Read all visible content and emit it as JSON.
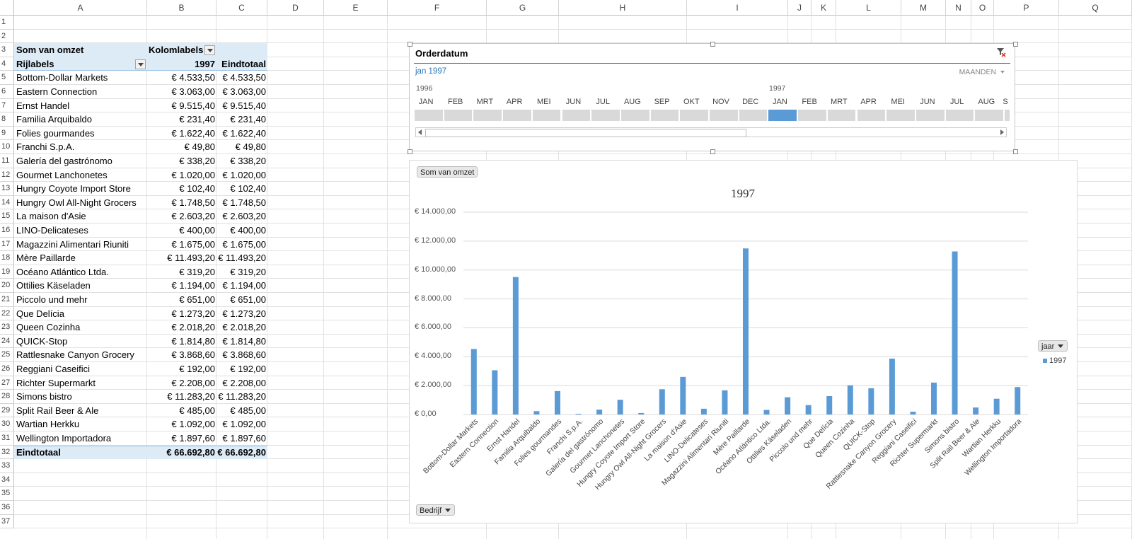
{
  "columns": [
    "A",
    "B",
    "C",
    "D",
    "E",
    "F",
    "G",
    "H",
    "I",
    "J",
    "K",
    "L",
    "M",
    "N",
    "O",
    "P",
    "Q"
  ],
  "rows": [
    "1",
    "2",
    "3",
    "4",
    "5",
    "6",
    "7",
    "8",
    "9",
    "10",
    "11",
    "12",
    "13",
    "14",
    "15",
    "16",
    "17",
    "18",
    "19",
    "20",
    "21",
    "22",
    "23",
    "24",
    "25",
    "26",
    "27",
    "28",
    "29",
    "30",
    "31",
    "32",
    "33",
    "34",
    "35",
    "36",
    "37"
  ],
  "pivot": {
    "value_field": "Som van omzet",
    "col_labels": "Kolomlabels",
    "row_labels": "Rijlabels",
    "col_year": "1997",
    "col_total": "Eindtotaal",
    "rows": [
      {
        "name": "Bottom-Dollar Markets",
        "v1997": "€ 4.533,50",
        "total": "€ 4.533,50"
      },
      {
        "name": "Eastern Connection",
        "v1997": "€ 3.063,00",
        "total": "€ 3.063,00"
      },
      {
        "name": "Ernst Handel",
        "v1997": "€ 9.515,40",
        "total": "€ 9.515,40"
      },
      {
        "name": "Familia Arquibaldo",
        "v1997": "€ 231,40",
        "total": "€ 231,40"
      },
      {
        "name": "Folies gourmandes",
        "v1997": "€ 1.622,40",
        "total": "€ 1.622,40"
      },
      {
        "name": "Franchi S.p.A.",
        "v1997": "€ 49,80",
        "total": "€ 49,80"
      },
      {
        "name": "Galería del gastrónomo",
        "v1997": "€ 338,20",
        "total": "€ 338,20"
      },
      {
        "name": "Gourmet Lanchonetes",
        "v1997": "€ 1.020,00",
        "total": "€ 1.020,00"
      },
      {
        "name": "Hungry Coyote Import Store",
        "v1997": "€ 102,40",
        "total": "€ 102,40"
      },
      {
        "name": "Hungry Owl All-Night Grocers",
        "v1997": "€ 1.748,50",
        "total": "€ 1.748,50"
      },
      {
        "name": "La maison d'Asie",
        "v1997": "€ 2.603,20",
        "total": "€ 2.603,20"
      },
      {
        "name": "LINO-Delicateses",
        "v1997": "€ 400,00",
        "total": "€ 400,00"
      },
      {
        "name": "Magazzini Alimentari Riuniti",
        "v1997": "€ 1.675,00",
        "total": "€ 1.675,00"
      },
      {
        "name": "Mère Paillarde",
        "v1997": "€ 11.493,20",
        "total": "€ 11.493,20"
      },
      {
        "name": "Océano Atlántico Ltda.",
        "v1997": "€ 319,20",
        "total": "€ 319,20"
      },
      {
        "name": "Ottilies Käseladen",
        "v1997": "€ 1.194,00",
        "total": "€ 1.194,00"
      },
      {
        "name": "Piccolo und mehr",
        "v1997": "€ 651,00",
        "total": "€ 651,00"
      },
      {
        "name": "Que Delícia",
        "v1997": "€ 1.273,20",
        "total": "€ 1.273,20"
      },
      {
        "name": "Queen Cozinha",
        "v1997": "€ 2.018,20",
        "total": "€ 2.018,20"
      },
      {
        "name": "QUICK-Stop",
        "v1997": "€ 1.814,80",
        "total": "€ 1.814,80"
      },
      {
        "name": "Rattlesnake Canyon Grocery",
        "v1997": "€ 3.868,60",
        "total": "€ 3.868,60"
      },
      {
        "name": "Reggiani Caseifici",
        "v1997": "€ 192,00",
        "total": "€ 192,00"
      },
      {
        "name": "Richter Supermarkt",
        "v1997": "€ 2.208,00",
        "total": "€ 2.208,00"
      },
      {
        "name": "Simons bistro",
        "v1997": "€ 11.283,20",
        "total": "€ 11.283,20"
      },
      {
        "name": "Split Rail Beer & Ale",
        "v1997": "€ 485,00",
        "total": "€ 485,00"
      },
      {
        "name": "Wartian Herkku",
        "v1997": "€ 1.092,00",
        "total": "€ 1.092,00"
      },
      {
        "name": "Wellington Importadora",
        "v1997": "€ 1.897,60",
        "total": "€ 1.897,60"
      }
    ],
    "grand_label": "Eindtotaal",
    "grand_1997": "€ 66.692,80",
    "grand_total": "€ 66.692,80"
  },
  "slicer": {
    "title": "Orderdatum",
    "selection": "jan 1997",
    "level": "MAANDEN",
    "year1": "1996",
    "year2": "1997",
    "months": [
      "JAN",
      "FEB",
      "MRT",
      "APR",
      "MEI",
      "JUN",
      "JUL",
      "AUG",
      "SEP",
      "OKT",
      "NOV",
      "DEC",
      "JAN",
      "FEB",
      "MRT",
      "APR",
      "MEI",
      "JUN",
      "JUL",
      "AUG",
      "S"
    ],
    "selected_index": 12
  },
  "chart_field_buttons": {
    "value": "Som van omzet",
    "axis": "Bedrijf",
    "legend": "jaar"
  },
  "colors": {
    "bar": "#5b9bd5",
    "pivot_header": "#ddebf7",
    "slicer_selected": "#5b9bd5",
    "link": "#2e75b6"
  },
  "chart_data": {
    "type": "bar",
    "title": "1997",
    "xlabel": "",
    "ylabel": "",
    "ylim": [
      0,
      14000
    ],
    "yticks": [
      "€ 0,00",
      "€ 2.000,00",
      "€ 4.000,00",
      "€ 6.000,00",
      "€ 8.000,00",
      "€ 10.000,00",
      "€ 12.000,00",
      "€ 14.000,00"
    ],
    "legend_position": "right",
    "categories": [
      "Bottom-Dollar Markets",
      "Eastern Connection",
      "Ernst Handel",
      "Familia Arquibaldo",
      "Folies gourmandes",
      "Franchi S.p.A.",
      "Galería del gastrónomo",
      "Gourmet Lanchonetes",
      "Hungry Coyote Import Store",
      "Hungry Owl All-Night Grocers",
      "La maison d'Asie",
      "LINO-Delicateses",
      "Magazzini Alimentari Riuniti",
      "Mère Paillarde",
      "Océano Atlántico Ltda.",
      "Ottilies Käseladen",
      "Piccolo und mehr",
      "Que Delícia",
      "Queen Cozinha",
      "QUICK-Stop",
      "Rattlesnake Canyon Grocery",
      "Reggiani Caseifici",
      "Richter Supermarkt",
      "Simons bistro",
      "Split Rail Beer & Ale",
      "Wartian Herkku",
      "Wellington Importadora"
    ],
    "series": [
      {
        "name": "1997",
        "values": [
          4533.5,
          3063.0,
          9515.4,
          231.4,
          1622.4,
          49.8,
          338.2,
          1020.0,
          102.4,
          1748.5,
          2603.2,
          400.0,
          1675.0,
          11493.2,
          319.2,
          1194.0,
          651.0,
          1273.2,
          2018.2,
          1814.8,
          3868.6,
          192.0,
          2208.0,
          11283.2,
          485.0,
          1092.0,
          1897.6
        ]
      }
    ]
  }
}
